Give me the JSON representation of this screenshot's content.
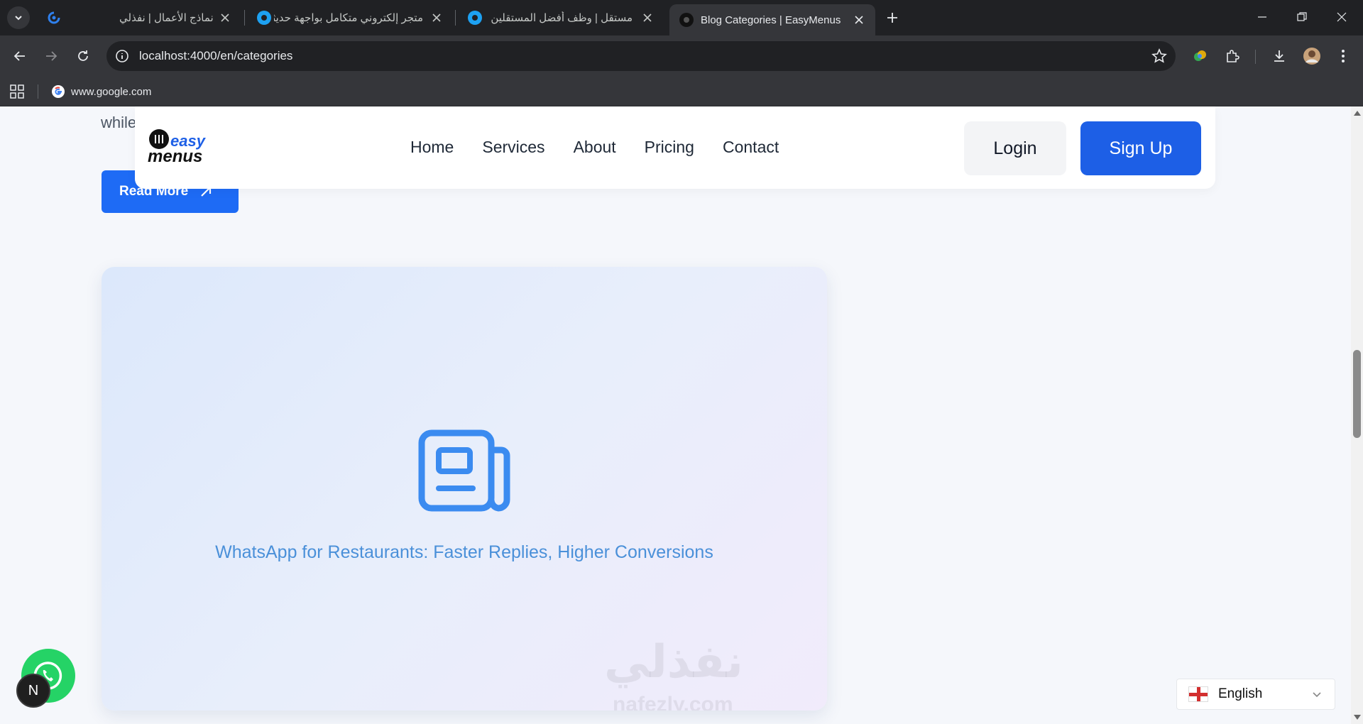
{
  "browser": {
    "tabs": [
      {
        "title": "نماذج الأعمال | نفذلي",
        "active": false
      },
      {
        "title": "متجر إلكتروني متكامل بواجهة حديثة",
        "active": false
      },
      {
        "title": "مستقل | وظف أفضل المستقلين",
        "active": false
      },
      {
        "title": "Blog Categories | EasyMenus",
        "active": true
      }
    ],
    "url": "localhost:4000/en/categories",
    "bookmarks": [
      {
        "label": "www.google.com"
      }
    ]
  },
  "page": {
    "prev_post_text": "while",
    "read_more_label": "Read More",
    "header": {
      "logo_text_top": "easy",
      "logo_text_bottom": "menus",
      "nav": [
        "Home",
        "Services",
        "About",
        "Pricing",
        "Contact"
      ],
      "login_label": "Login",
      "signup_label": "Sign Up"
    },
    "card": {
      "icon": "newspaper-icon",
      "title": "WhatsApp for Restaurants: Faster Replies, Higher Conversions"
    },
    "watermark": {
      "arabic": "نفذلي",
      "latin": "nafezly.com"
    },
    "chat_badge": "N",
    "language": {
      "label": "English",
      "flag": "england-flag"
    }
  },
  "colors": {
    "primary": "#1d5fe6",
    "card_title": "#4a90d9",
    "whatsapp": "#25d366"
  }
}
